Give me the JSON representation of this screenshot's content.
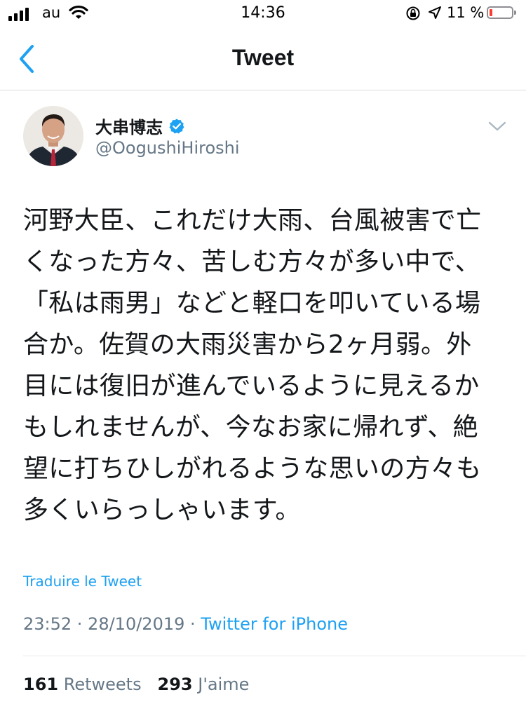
{
  "status_bar": {
    "carrier": "au",
    "time": "14:36",
    "battery": "11 %",
    "battery_level": 0.11,
    "battery_color": "#ff3b30",
    "icons": [
      "signal-icon",
      "wifi-icon",
      "rotation-lock-icon",
      "location-arrow-icon",
      "battery-icon"
    ]
  },
  "nav": {
    "title": "Tweet",
    "back_icon": "chevron-left-icon",
    "accent": "#1da1f2"
  },
  "author": {
    "name": "大串博志",
    "handle": "@OogushiHiroshi",
    "verified": true
  },
  "tweet": {
    "text": "河野大臣、これだけ大雨、台風被害で亡\nくなった方々、苦しむ方々が多い中で、\n「私は雨男」などと軽口を叩いている場\n合か。佐賀の大雨災害から2ヶ月弱。外\n目には復旧が進んでいるように見えるか\nもしれませんが、今なお家に帰れず、絶\n望に打ちひしがれるような思いの方々も\n多くいらっしゃいます。",
    "translate_label": "Traduire le Tweet",
    "datetime": "23:52 · 28/10/2019 · ",
    "source": "Twitter for iPhone"
  },
  "stats": {
    "retweets_count": "161",
    "retweets_label": "Retweets",
    "likes_count": "293",
    "likes_label": "J'aime"
  }
}
